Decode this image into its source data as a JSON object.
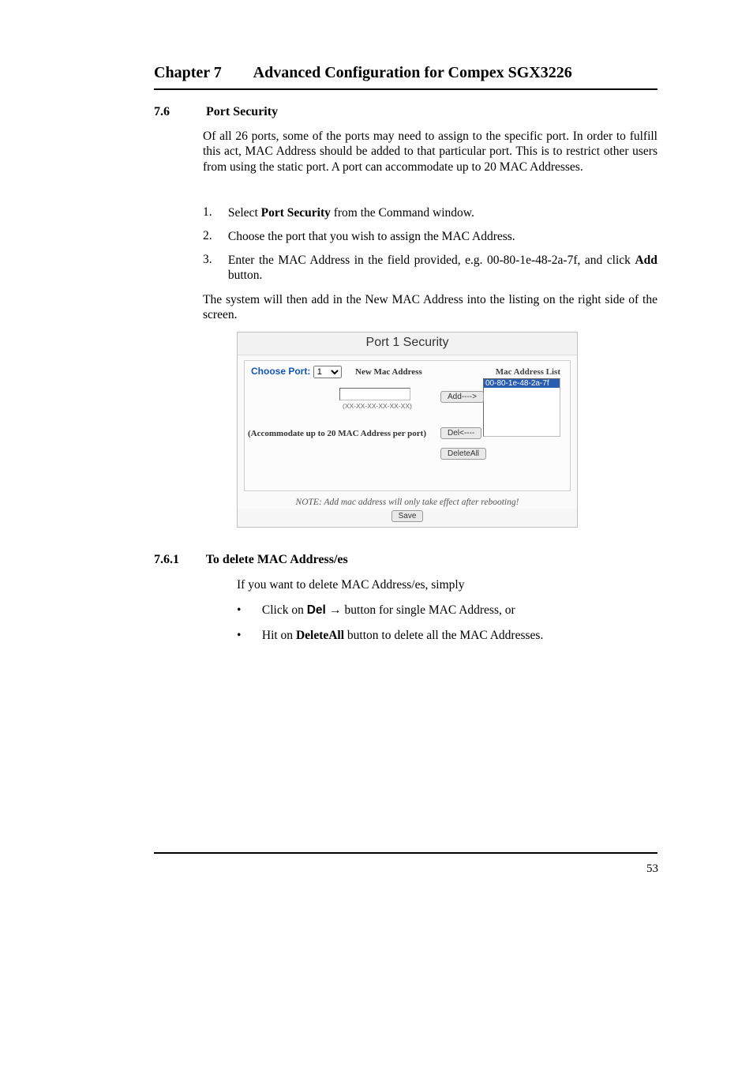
{
  "header": {
    "chapter": "Chapter 7",
    "title": "Advanced Configuration for Compex SGX3226"
  },
  "section": {
    "number": "7.6",
    "title": "Port Security"
  },
  "paragraph1": "Of all 26 ports, some of the ports may need to assign to the specific port. In order to fulfill this act, MAC Address should be added to that particular port. This is to restrict other users from using the static port. A port can accommodate up to 20 MAC Addresses.",
  "steps": {
    "s1": {
      "num": "1.",
      "pre": "Select ",
      "bold": "Port Security",
      "post": " from the Command window."
    },
    "s2": {
      "num": "2.",
      "text": "Choose the port that you wish to assign the MAC Address."
    },
    "s3": {
      "num": "3.",
      "pre": "Enter the MAC Address in the field provided, e.g. 00-80-1e-48-2a-7f, and click ",
      "bold": "Add",
      "post": " button."
    }
  },
  "paragraph2": "The system will then add in the New MAC Address into the listing on the right side of the screen.",
  "screenshot": {
    "title": "Port 1 Security",
    "choose_label": "Choose Port:",
    "choose_value": "1",
    "new_mac_label": "New Mac Address",
    "mac_list_label": "Mac Address List",
    "mac_list_item": "00-80-1e-48-2a-7f",
    "hint": "(XX-XX-XX-XX-XX-XX)",
    "accommodate": "(Accommodate up to 20 MAC Address per port)",
    "btn_add": "Add---->",
    "btn_del": "Del<----",
    "btn_delall": "DeleteAll",
    "note": "NOTE: Add mac address will only take effect after rebooting!",
    "btn_save": "Save"
  },
  "subsection": {
    "number": "7.6.1",
    "title": "To delete MAC Address/es"
  },
  "paragraph3": "If you want to delete MAC Address/es, simply",
  "bullets": {
    "b1": {
      "pre": "Click on ",
      "bold": "Del →",
      "post": " button for single MAC Address, or"
    },
    "b2": {
      "pre": "Hit on ",
      "bold": "DeleteAll",
      "post": " button to delete all the MAC Addresses."
    }
  },
  "page_number": "53"
}
